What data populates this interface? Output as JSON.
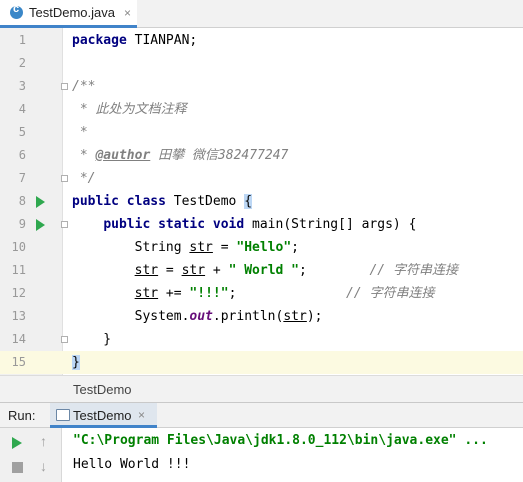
{
  "tab": {
    "filename": "TestDemo.java",
    "close": "×"
  },
  "editor": {
    "line_numbers": [
      "1",
      "2",
      "3",
      "4",
      "5",
      "6",
      "7",
      "8",
      "9",
      "10",
      "11",
      "12",
      "13",
      "14",
      "15"
    ],
    "l1": {
      "kw": "package",
      "rest": " TIANPAN;"
    },
    "l3": "/**",
    "l4": " * 此处为文档注释",
    "l5": " *",
    "l6": {
      "pre": " * ",
      "tag": "@author",
      "rest": " 田攀 微信382477247"
    },
    "l7": " */",
    "l8": {
      "kw": "public class",
      "name": " TestDemo ",
      "brace": "{"
    },
    "l9": {
      "indent": "    ",
      "kw": "public static void",
      "rest": " main(String[] args) {"
    },
    "l10": {
      "a": "        String ",
      "var": "str",
      "b": " = ",
      "s": "\"Hello\"",
      "c": ";"
    },
    "l11": {
      "a": "        ",
      "var1": "str",
      "b": " = ",
      "var2": "str",
      "c": " + ",
      "s": "\" World \"",
      "d": ";        ",
      "cm": "// 字符串连接"
    },
    "l12": {
      "a": "        ",
      "var": "str",
      "b": " += ",
      "s": "\"!!!\"",
      "c": ";              ",
      "cm": "// 字符串连接"
    },
    "l13": {
      "a": "        System.",
      "fld": "out",
      "b": ".println(",
      "var": "str",
      "c": ");"
    },
    "l14": "    }",
    "l15": "}"
  },
  "breadcrumb": "TestDemo",
  "run": {
    "label": "Run:",
    "tab_name": "TestDemo",
    "tab_close": "×",
    "command": "\"C:\\Program Files\\Java\\jdk1.8.0_112\\bin\\java.exe\" ...",
    "output": "Hello World !!!",
    "up_arrow": "↑",
    "down_arrow": "↓"
  },
  "colors": {
    "keyword": "#000080",
    "string": "#008000",
    "comment": "#808080",
    "run_green": "#2fa84f",
    "accent": "#4083c9"
  }
}
